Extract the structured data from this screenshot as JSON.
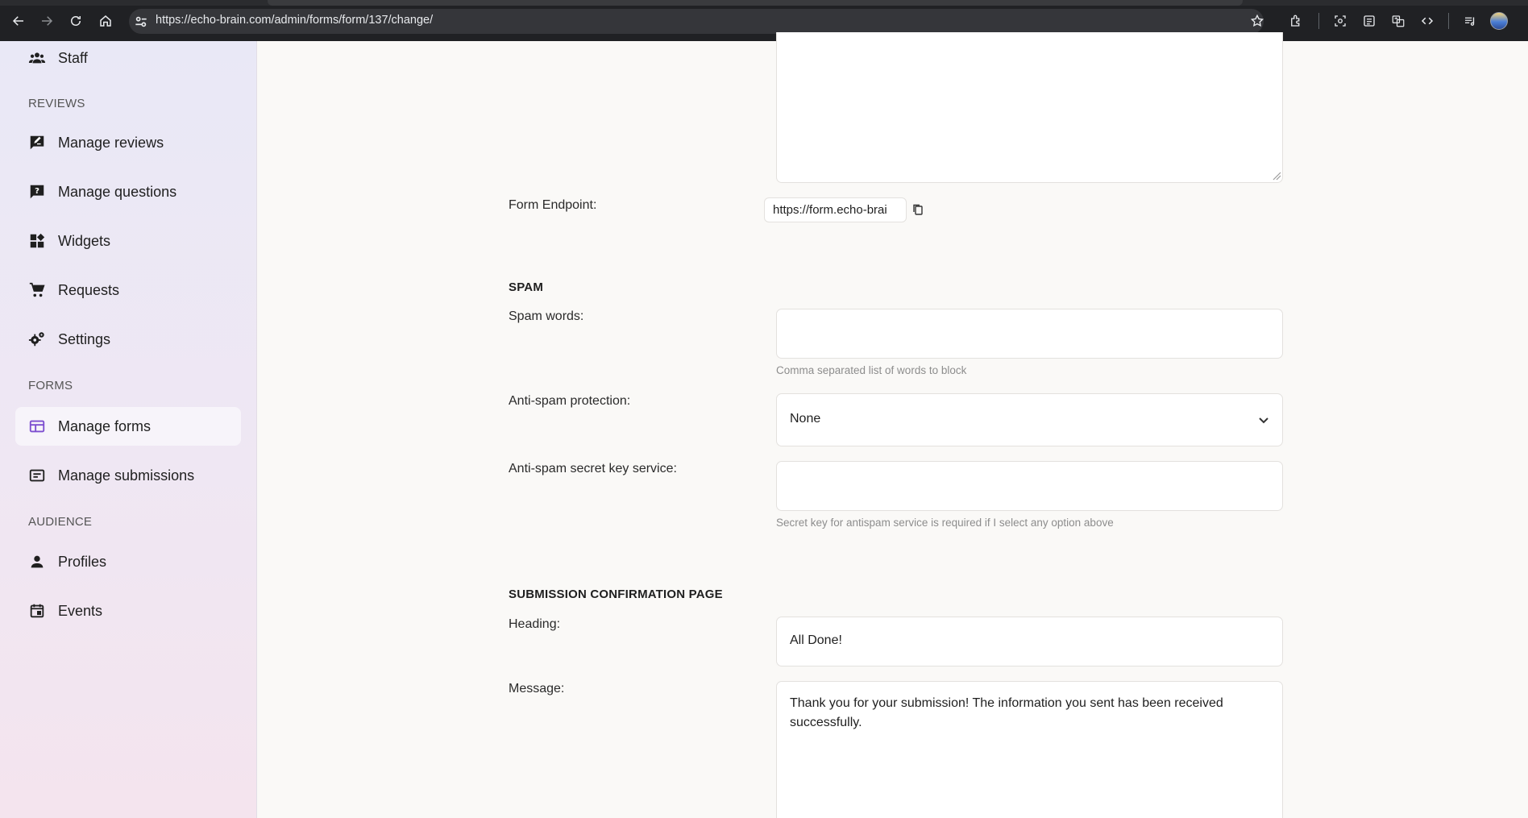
{
  "browser": {
    "url": "https://echo-brain.com/admin/forms/form/137/change/",
    "icons": [
      "back-arrow-icon",
      "forward-arrow-icon",
      "reload-icon",
      "home-icon",
      "site-settings-icon",
      "bookmark-star-icon",
      "extensions-icon",
      "screenshot-icon",
      "reading-mode-icon",
      "translate-icon",
      "devtools-icon",
      "media-control-icon",
      "profile-avatar"
    ]
  },
  "sidebar": {
    "top_item": {
      "label": "Staff",
      "icon": "staff-icon"
    },
    "sections": [
      {
        "title": "REVIEWS",
        "items": [
          {
            "label": "Manage reviews",
            "icon": "review-edit-icon"
          },
          {
            "label": "Manage questions",
            "icon": "question-icon"
          },
          {
            "label": "Widgets",
            "icon": "widgets-icon"
          },
          {
            "label": "Requests",
            "icon": "cart-icon"
          },
          {
            "label": "Settings",
            "icon": "gears-icon"
          }
        ]
      },
      {
        "title": "FORMS",
        "items": [
          {
            "label": "Manage forms",
            "icon": "form-table-icon",
            "active": true
          },
          {
            "label": "Manage submissions",
            "icon": "submissions-icon"
          }
        ]
      },
      {
        "title": "AUDIENCE",
        "items": [
          {
            "label": "Profiles",
            "icon": "person-icon"
          },
          {
            "label": "Events",
            "icon": "calendar-icon"
          }
        ]
      }
    ]
  },
  "form": {
    "endpoint": {
      "label": "Form Endpoint:",
      "value": "https://form.echo-brai"
    },
    "spam": {
      "title": "SPAM",
      "spam_words": {
        "label": "Spam words:",
        "value": "",
        "help": "Comma separated list of words to block"
      },
      "anti_spam": {
        "label": "Anti-spam protection:",
        "value": "None"
      },
      "secret_key": {
        "label": "Anti-spam secret key service:",
        "value": "",
        "help": "Secret key for antispam service is required if I select any option above"
      }
    },
    "confirmation": {
      "title": "SUBMISSION CONFIRMATION PAGE",
      "heading": {
        "label": "Heading:",
        "value": "All Done!"
      },
      "message": {
        "label": "Message:",
        "line1": "Thank you for your submission! The information you sent has been received",
        "line2": "successfully."
      }
    }
  }
}
